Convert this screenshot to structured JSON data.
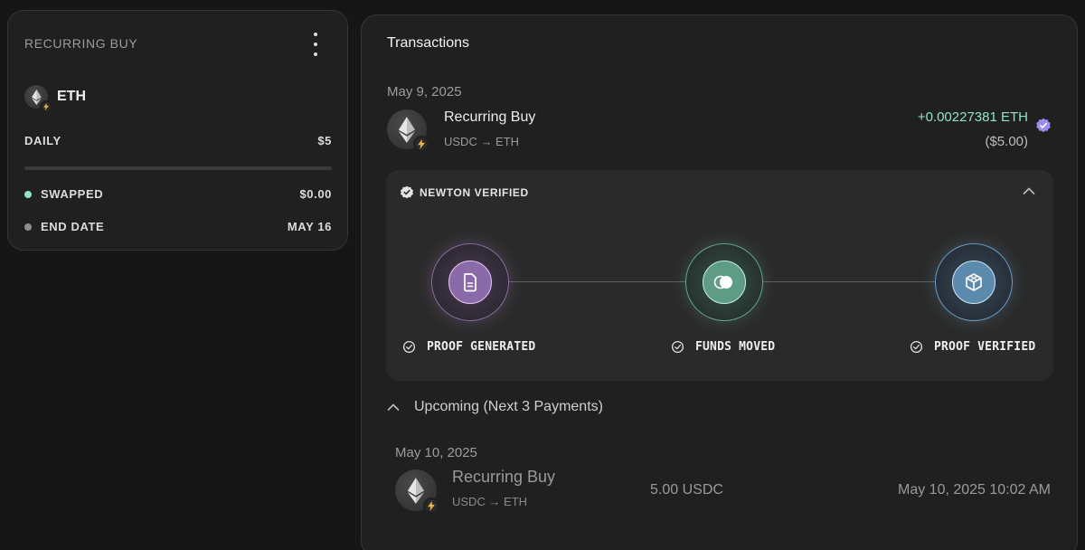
{
  "recurring": {
    "title": "RECURRING BUY",
    "asset": "ETH",
    "frequency_label": "DAILY",
    "frequency_amount": "$5",
    "progress": 0,
    "swapped_label": "SWAPPED",
    "swapped_value": "$0.00",
    "end_label": "END DATE",
    "end_value": "MAY 16"
  },
  "transactions": {
    "title": "Transactions",
    "date": "May 9, 2025",
    "item": {
      "name": "Recurring Buy",
      "pair": "USDC → ETH",
      "amount": "+0.00227381 ETH",
      "fiat": "($5.00)"
    },
    "newton": {
      "label": "NEWTON VERIFIED",
      "steps": [
        {
          "label": "PROOF GENERATED",
          "icon": "document-icon"
        },
        {
          "label": "FUNDS MOVED",
          "icon": "transfer-icon"
        },
        {
          "label": "PROOF VERIFIED",
          "icon": "cube-icon"
        }
      ]
    },
    "upcoming": {
      "header": "Upcoming (Next 3 Payments)",
      "date": "May 10, 2025",
      "item": {
        "name": "Recurring Buy",
        "pair": "USDC → ETH",
        "amount": "5.00 USDC",
        "time": "May 10, 2025 10:02 AM"
      }
    }
  },
  "colors": {
    "accent_green": "#8fe3c6",
    "step1": "#c79be8",
    "step2": "#7fd6b0",
    "step3": "#7fbde8",
    "verified": "#9b8cf0"
  }
}
